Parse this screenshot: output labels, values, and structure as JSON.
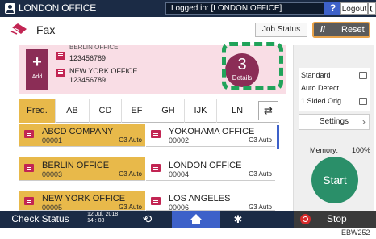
{
  "topbar": {
    "title": "LONDON OFFICE",
    "logged_in": "Logged in: [LONDON OFFICE]",
    "help": "?",
    "logout": "Logout"
  },
  "app": {
    "title": "Fax",
    "job_status": "Job Status",
    "reset": "Reset"
  },
  "destinations": {
    "add_label": "Add",
    "add_symbol": "+",
    "cut_top": "BERLIN OFFICE",
    "items": [
      {
        "name": "",
        "number": "123456789"
      },
      {
        "name": "NEW YORK OFFICE",
        "number": "123456789"
      }
    ],
    "details_count": "3",
    "details_label": "Details"
  },
  "tabs": [
    "Freq.",
    "AB",
    "CD",
    "EF",
    "GH",
    "IJK",
    "LN"
  ],
  "sort_icon": "⇄",
  "entries": [
    {
      "name": "ABCD COMPANY",
      "number": "00001",
      "mode": "G3 Auto",
      "selected": true
    },
    {
      "name": "YOKOHAMA OFFICE",
      "number": "00002",
      "mode": "G3 Auto",
      "selected": false
    },
    {
      "name": "BERLIN OFFICE",
      "number": "00003",
      "mode": "G3 Auto",
      "selected": true
    },
    {
      "name": "LONDON OFFICE",
      "number": "00004",
      "mode": "G3 Auto",
      "selected": false
    },
    {
      "name": "NEW YORK OFFICE",
      "number": "00005",
      "mode": "G3 Auto",
      "selected": true
    },
    {
      "name": "LOS ANGELES",
      "number": "00006",
      "mode": "G3 Auto",
      "selected": false
    }
  ],
  "settings": {
    "lines": [
      "Standard",
      "Auto Detect",
      "1 Sided Orig."
    ],
    "button": "Settings",
    "memory_label": "Memory:",
    "memory_value": "100%",
    "start": "Start"
  },
  "bottombar": {
    "check_status": "Check Status",
    "date": "12 Jul. 2018",
    "time": "14 : 08",
    "stop": "Stop"
  },
  "image_code": "EBW252",
  "colors": {
    "bar": "#1b2b45",
    "accent": "#8b2d56",
    "highlight": "#e8b94a",
    "start": "#2a8f69",
    "callout": "#21a35a"
  }
}
